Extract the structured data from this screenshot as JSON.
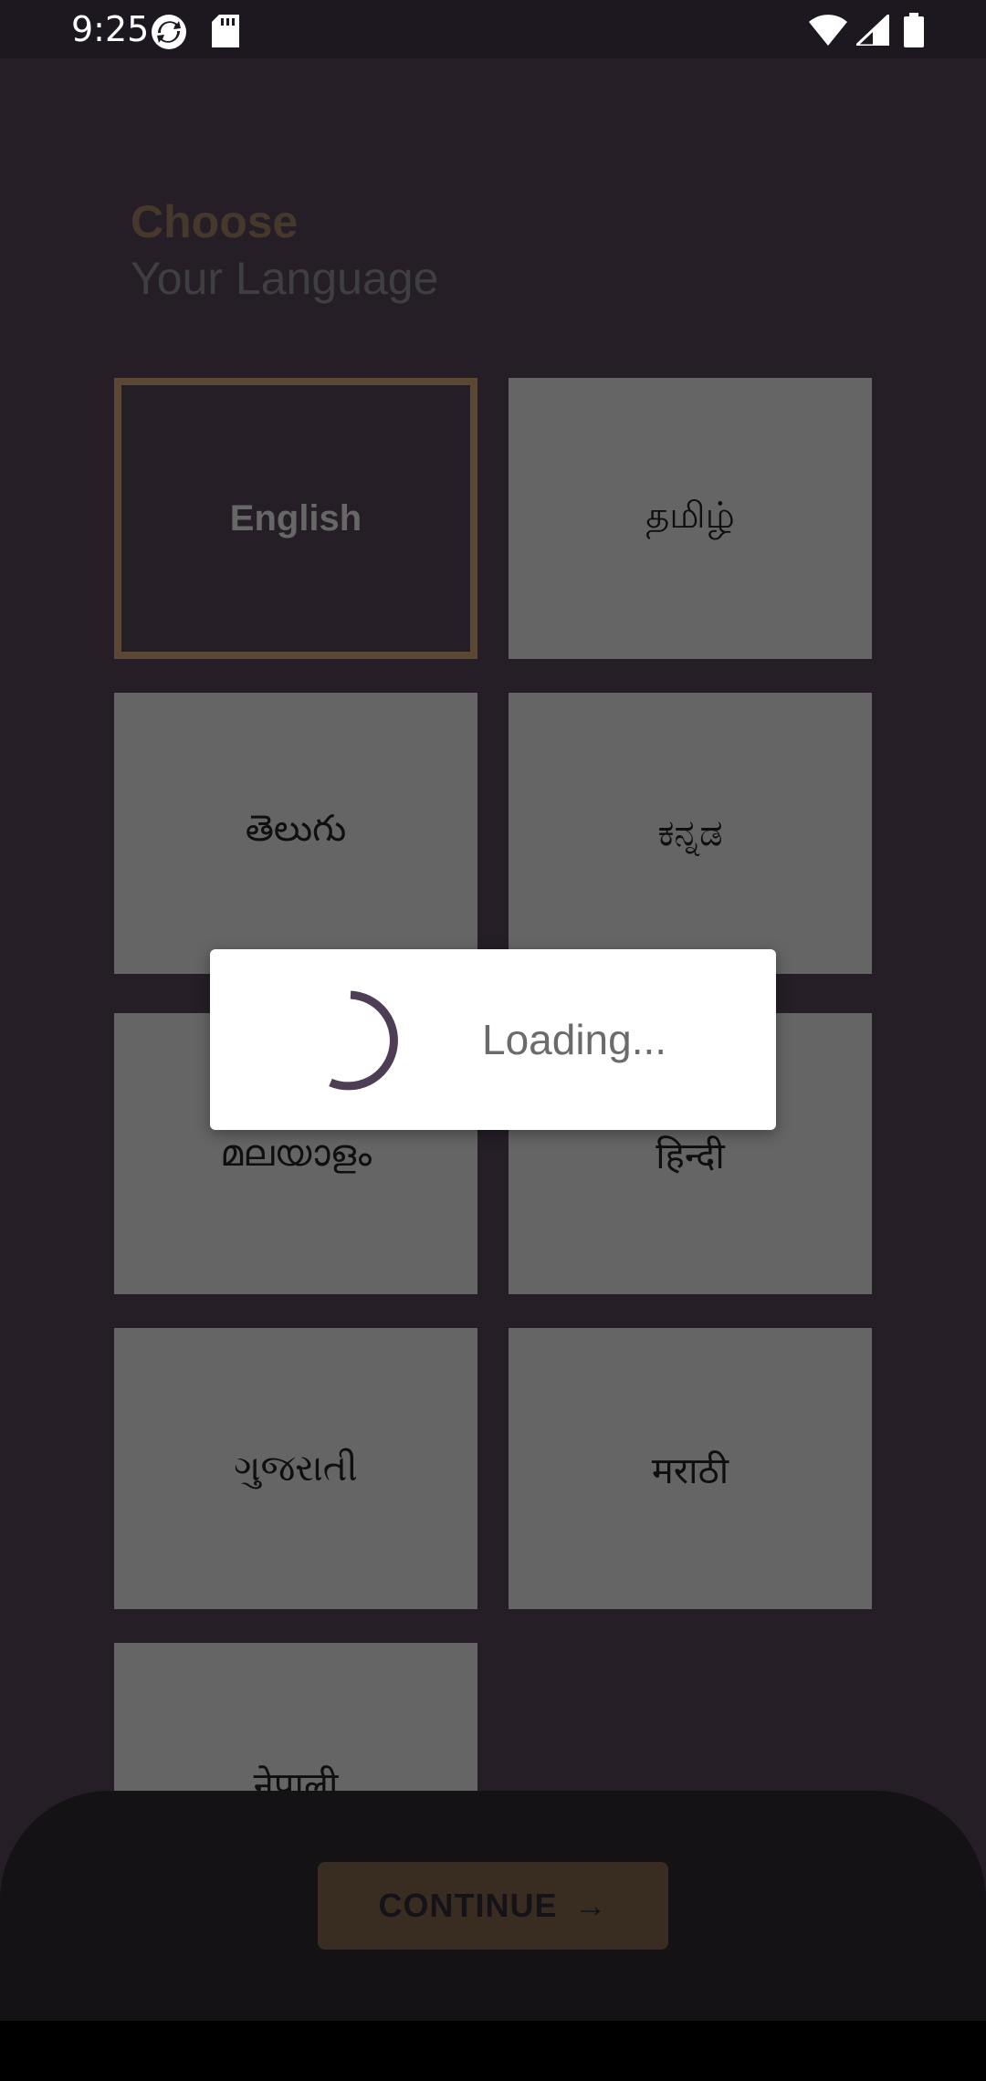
{
  "status_bar": {
    "time": "9:25",
    "icons": [
      "sync-app-icon",
      "sd-card-icon",
      "wifi-icon",
      "cellular-signal-icon",
      "battery-icon"
    ]
  },
  "header": {
    "title_line1": "Choose",
    "title_line2": "Your Language"
  },
  "languages": [
    {
      "label": "English",
      "selected": true
    },
    {
      "label": "தமிழ்",
      "selected": false
    },
    {
      "label": "తెలుగు",
      "selected": false
    },
    {
      "label": "ಕನ್ನಡ",
      "selected": false
    },
    {
      "label": "മലയാളം",
      "selected": false
    },
    {
      "label": "हिन्दी",
      "selected": false
    },
    {
      "label": "ગુજરાતી",
      "selected": false
    },
    {
      "label": "मराठी",
      "selected": false
    },
    {
      "label": "नेपाली",
      "selected": false
    }
  ],
  "footer": {
    "continue_label": "CONTINUE",
    "continue_arrow": "→"
  },
  "dialog": {
    "loading_text": "Loading..."
  },
  "colors": {
    "accent": "#b48f68",
    "background": "#4a3d4e",
    "tile": "#cbcbcb"
  }
}
